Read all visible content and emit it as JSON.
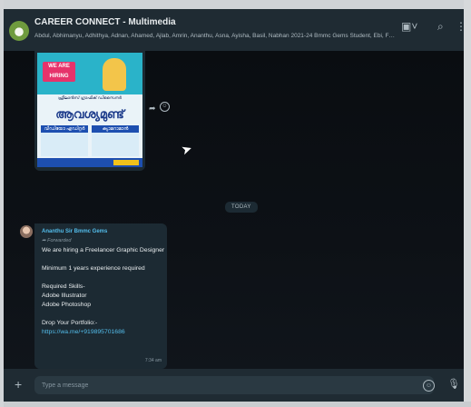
{
  "header": {
    "title": "CAREER CONNECT - Multimedia",
    "members": "Abdul, Abhimanyu, Adhithya, Adnan, Ahamed, Ajlab, Amrin, Ananthu, Asna, Ayisha, Basil, Nabhan 2021-24 Bmmc Gems Student, Ebi, Farha, ...",
    "icons": [
      "video-icon",
      "search-icon",
      "menu-icon"
    ]
  },
  "chat": {
    "image_message": {
      "poster": {
        "badge": "WE ARE HIRING",
        "subtitle": "ഫ്രീലാൻസ് ഗ്രാഫിക് ഡിസൈനർ",
        "headline": "ആവശ്യമുണ്ട്",
        "col_left": "വീഡിയോ എഡിറ്റർ",
        "col_right": "ക്യാമറാമാൻ"
      },
      "icons": [
        "forward-icon",
        "reaction-icon"
      ]
    },
    "date_divider": "TODAY",
    "text_message": {
      "sender": "Ananthu Sir Bmmc Gems",
      "forwarded": "Forwarded",
      "lines": [
        "We are hiring a Freelancer Graphic Designer",
        "Minimum 1 years experience required",
        "Required Skills-",
        "Adobe Illustrator",
        "Adobe Photoshop",
        "Drop Your Portfolio:-"
      ],
      "link": "https://wa.me/+919895701686",
      "time": "7:34 am"
    }
  },
  "composer": {
    "placeholder": "Type a message",
    "icons": [
      "plus-icon",
      "emoji-icon",
      "mic-icon"
    ]
  },
  "colors": {
    "header_bg": "#1f2b33",
    "bubble_bg": "#1c2a33",
    "sender_color": "#53bdeb",
    "link_color": "#53bdeb"
  }
}
